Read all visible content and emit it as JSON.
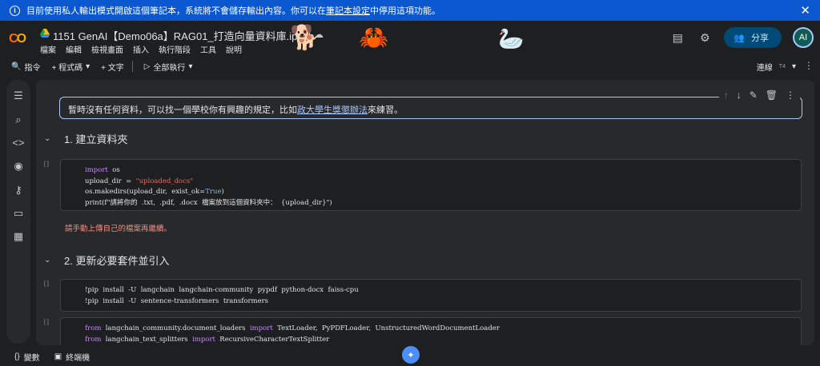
{
  "banner": {
    "text_before": "目前使用私人輸出模式開啟這個筆記本，系統將不會儲存輸出內容。你可以在",
    "link": "筆記本設定",
    "text_after": "中停用這項功能。",
    "icons": {
      "info": "info-icon",
      "close": "close-icon"
    }
  },
  "header": {
    "logo": "CO",
    "title": "1151 GenAI【Demo06a】RAG01_打造向量資料庫.ipynb",
    "menu": [
      "檔案",
      "編輯",
      "檢視畫面",
      "插入",
      "執行階段",
      "工具",
      "說明"
    ],
    "share_label": "分享",
    "avatar_initials": "AI",
    "icons": [
      "comment-icon",
      "gear-icon",
      "people-icon"
    ]
  },
  "toolbar": {
    "command_label": "指令",
    "code_label": "+ 程式碼",
    "text_label": "+ 文字",
    "run_all_label": "全部執行",
    "runtime_label": "連線",
    "runtime_type": "T4"
  },
  "sidebar": {
    "icons": [
      "table-of-contents-icon",
      "find-icon",
      "code-snippets-icon",
      "variable-inspector-icon",
      "secrets-key-icon",
      "folder-icon",
      "terminal-table-icon"
    ]
  },
  "notebook": {
    "text_cell": {
      "before": "暫時沒有任何資料，可以找一個學校你有興趣的規定，比如",
      "link": "政大學生獎懲辦法",
      "after": "來練習。"
    },
    "cell_tools": [
      "move-up-icon",
      "move-down-icon",
      "edit-icon",
      "delete-icon",
      "more-icon"
    ],
    "section1": "1. 建立資料夾",
    "section2": "2. 更新必要套件並引入",
    "run_marker": "[ ]",
    "output_warning": "請手動上傳自己的檔案再繼續。"
  },
  "code": {
    "cell1": [
      [
        "import",
        "  os"
      ],
      [
        "upload_dir",
        "  =  ",
        "\"uploaded_docs\""
      ],
      [
        "os.makedirs(upload_dir,  exist_ok=",
        "True",
        ")"
      ],
      [
        "print(f\"請將你的  .txt,  .pdf,  .docx  檔案放到這個資料夾中：  {upload_dir}\")"
      ]
    ],
    "cell2": [
      "!pip  install  -U  langchain  langchain-community  pypdf  python-docx  faiss-cpu",
      "!pip  install  -U  sentence-transformers  transformers"
    ],
    "cell3": [
      [
        "from",
        "  langchain_community.document_loaders  ",
        "import",
        "  TextLoader,  PyPDFLoader,  UnstructuredWordDocumentLoader"
      ],
      [
        "from",
        "  langchain_text_splitters  ",
        "import",
        "  RecursiveCharacterTextSplitter"
      ]
    ]
  },
  "bottom": {
    "variables_label": "變數",
    "terminal_label": "終端機"
  }
}
